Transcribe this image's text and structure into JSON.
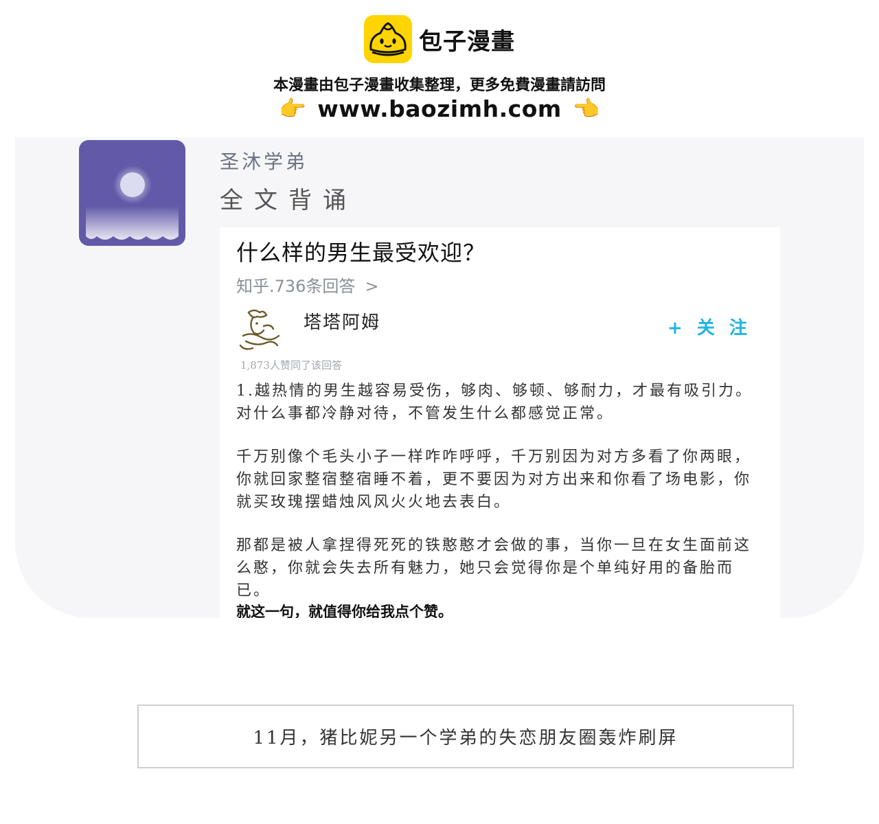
{
  "watermark": {
    "logo_icon": "bun-mascot-icon",
    "logo_text": "包子漫畫",
    "notice": "本漫畫由包子漫畫收集整理，更多免費漫畫請訪問",
    "url": "www.baozimh.com",
    "left_hand": "👉",
    "right_hand": "👈"
  },
  "message": {
    "sender": "圣沐学弟",
    "text": "全文背诵",
    "avatar_icon": "moon-over-waves-icon",
    "avatar_color": "#625aa8"
  },
  "shared_answer": {
    "question": "什么样的男生最受欢迎？",
    "meta": "知乎.736条回答",
    "meta_chevron": ">",
    "author_name": "塔塔阿姆",
    "author_avatar_icon": "ink-sketch-avatar-icon",
    "follow_label": "+ 关 注",
    "follow_color": "#1fb4e3",
    "likes": "1,873人赞同了该回答",
    "paragraphs": [
      "1.越热情的男生越容易受伤，够肉、够顿、够耐力，才最有吸引力。\n对什么事都冷静对待，不管发生什么都感觉正常。",
      "千万别像个毛头小子一样咋咋呼呼，千万别因为对方多看了你两眼，你就回家整宿整宿睡不着，更不要因为对方出来和你看了场电影，你就买玫瑰摆蜡烛风风火火地去表白。",
      "那都是被人拿捏得死死的铁憨憨才会做的事，当你一旦在女生面前这么憨，你就会失去所有魅力，她只会觉得你是个单纯好用的备胎而已。"
    ],
    "closing": "就这一句，就值得你给我点个赞。"
  },
  "caption": {
    "text": "11月，猪比妮另一个学弟的失恋朋友圈轰炸刷屏"
  }
}
